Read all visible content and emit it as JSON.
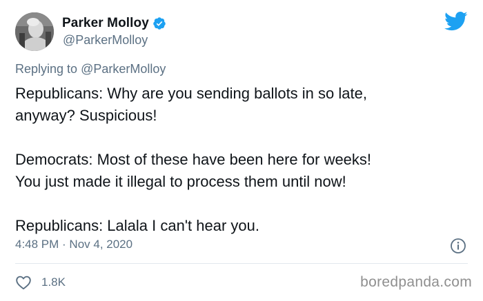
{
  "author": {
    "display_name": "Parker Molloy",
    "handle": "@ParkerMolloy",
    "verified_icon": "verified-badge-icon",
    "avatar_icon": "avatar"
  },
  "brand": {
    "icon": "twitter-bird-icon",
    "color": "#1da1f2"
  },
  "reply": {
    "prefix": "Replying to",
    "mention": "@ParkerMolloy"
  },
  "tweet": {
    "paragraphs": [
      {
        "lines": [
          "Republicans: Why are you sending ballots in so late,",
          "anyway? Suspicious!"
        ]
      },
      {
        "lines": [
          "Democrats: Most of these have been here for weeks!",
          "You just made it illegal to process them until now!"
        ]
      },
      {
        "lines": [
          "Republicans: Lalala I can't hear you."
        ]
      }
    ]
  },
  "meta": {
    "timestamp": "4:48 PM · Nov 4, 2020",
    "info_icon": "info-icon"
  },
  "engagement": {
    "like_icon": "heart-icon",
    "like_count": "1.8K"
  },
  "watermark": "boredpanda.com",
  "colors": {
    "text": "#0f1419",
    "secondary": "#5b7083",
    "divider": "#e1e8ed",
    "verified": "#1da1f2"
  }
}
